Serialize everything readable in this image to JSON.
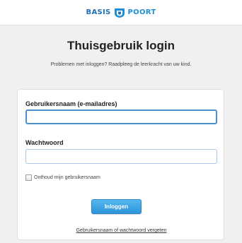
{
  "header": {
    "logo_left": "BASIS",
    "logo_right": "POORT",
    "brand_color": "#1f6fb5",
    "logo_icon": "basispoort-shield-icon"
  },
  "page": {
    "title": "Thuisgebruik login",
    "subtitle": "Problemen met inloggen? Raadpleeg de leerkracht van uw kind."
  },
  "form": {
    "username_label": "Gebruikersnaam (e-mailadres)",
    "username_value": "",
    "password_label": "Wachtwoord",
    "password_value": "",
    "remember_label": "Onthoud mijn gebruikersnaam",
    "remember_checked": false,
    "login_button": "Inloggen",
    "forgot_link": "Gebruikersnaam of wachtwoord vergeten",
    "accent_color": "#2c94d8"
  }
}
